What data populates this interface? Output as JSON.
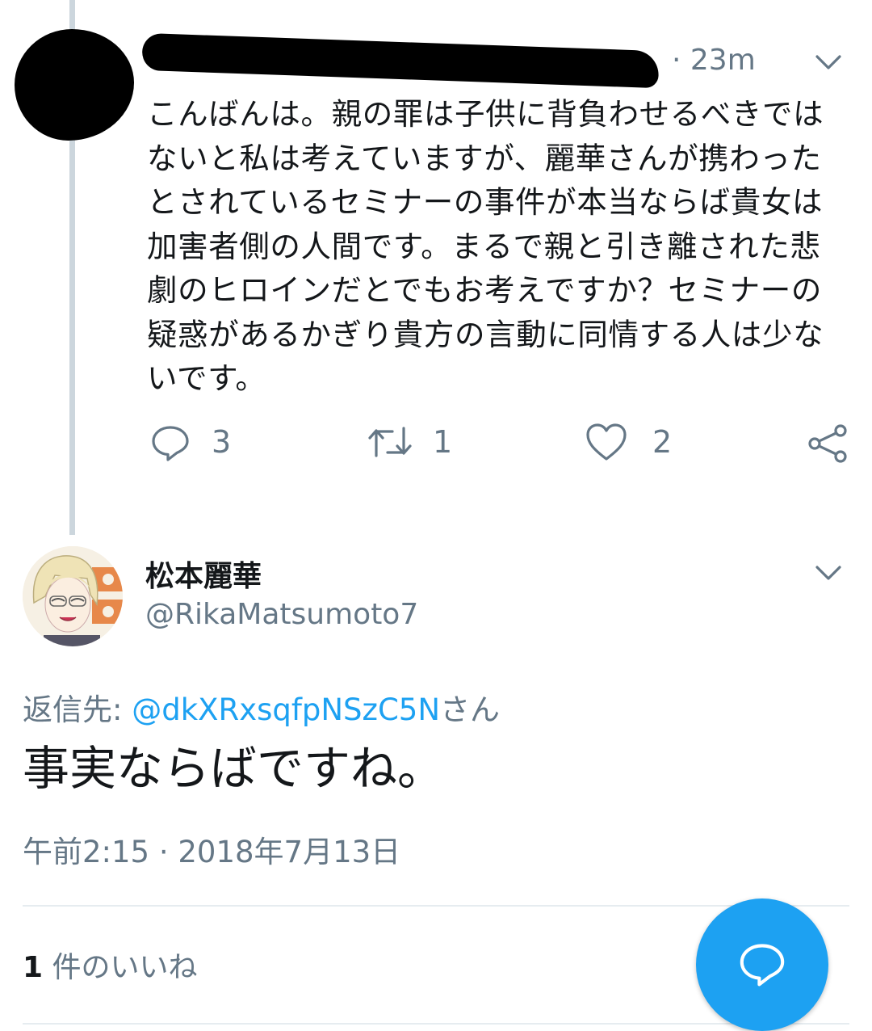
{
  "reply_tweet": {
    "time": "· 23m",
    "text": "こんばんは。親の罪は子供に背負わせるべきではないと私は考えていますが、麗華さんが携わったとされているセミナーの事件が本当ならば貴女は加害者側の人間です。まるで親と引き離された悲劇のヒロインだとでもお考えですか？セミナーの疑惑があるかぎり貴方の言動に同情する人は少ないです。",
    "actions": {
      "reply_count": "3",
      "retweet_count": "1",
      "like_count": "2"
    },
    "icons": [
      "redacted-avatar",
      "chevron-down-icon",
      "reply-icon",
      "retweet-icon",
      "heart-icon",
      "share-icon"
    ]
  },
  "main_tweet": {
    "display_name": "松本麗華",
    "handle": "@RikaMatsumoto7",
    "replying_prefix": "返信先: ",
    "replying_to": "@dkXRxsqfpNSzC5N",
    "replying_suffix": "さん",
    "text": "事実ならばですね。",
    "timestamp": "午前2:15 · 2018年7月13日",
    "likes_count": "1",
    "likes_label": " 件のいいね",
    "icons": [
      "avatar",
      "chevron-down-icon",
      "compose-reply-icon"
    ]
  },
  "colors": {
    "accent": "#1da1f2",
    "secondary_text": "#657786",
    "primary_text": "#14171a",
    "thread_line": "#ccd6dd",
    "divider": "#e6ecf0"
  }
}
